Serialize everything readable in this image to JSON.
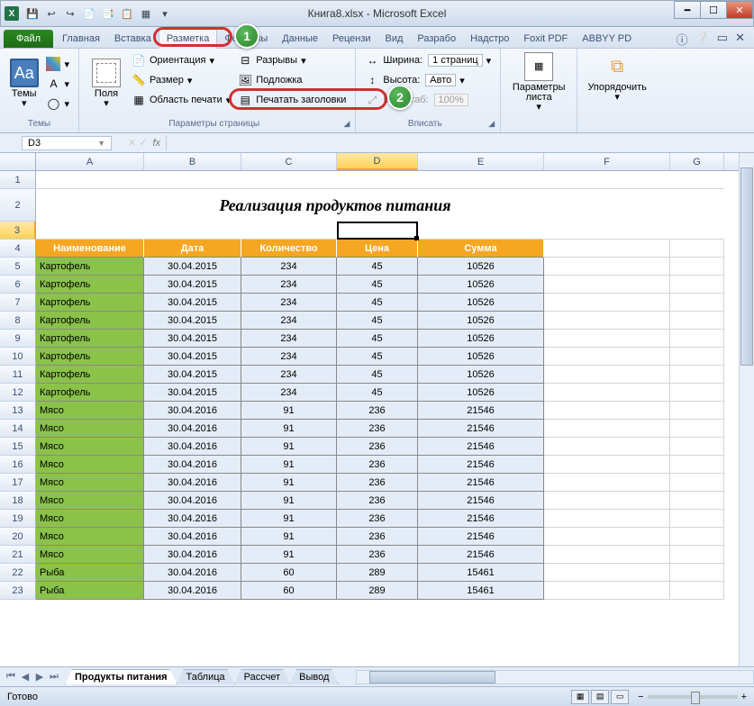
{
  "window": {
    "title": "Книга8.xlsx - Microsoft Excel",
    "qat": [
      "💾",
      "↩",
      "↪",
      "📄",
      "📑",
      "📋",
      "▦",
      "▾"
    ]
  },
  "tabs": {
    "file": "Файл",
    "items": [
      "Главная",
      "Вставка",
      "Разметка",
      "Формулы",
      "Данные",
      "Рецензи",
      "Вид",
      "Разрабо",
      "Надстро",
      "Foxit PDF",
      "ABBYY PD"
    ],
    "active_index": 2
  },
  "ribbon": {
    "themes": {
      "big": "Темы",
      "group": "Темы"
    },
    "page_setup": {
      "margins": "Поля",
      "orientation": "Ориентация",
      "size": "Размер",
      "print_area": "Область печати",
      "breaks": "Разрывы",
      "background": "Подложка",
      "print_titles": "Печатать заголовки",
      "group": "Параметры страницы"
    },
    "scale": {
      "width_lbl": "Ширина:",
      "width_val": "1 страниц",
      "height_lbl": "Высота:",
      "height_val": "Авто",
      "scale_lbl": "Масштаб:",
      "scale_val": "100%",
      "group": "Вписать"
    },
    "sheet_opts": {
      "big": "Параметры листа"
    },
    "arrange": {
      "big": "Упорядочить"
    }
  },
  "namebox": "D3",
  "fx": "fx",
  "columns": [
    "A",
    "B",
    "C",
    "D",
    "E",
    "F",
    "G"
  ],
  "title_text": "Реализация продуктов питания",
  "headers": [
    "Наименование",
    "Дата",
    "Количество",
    "Цена",
    "Сумма"
  ],
  "data_rows": [
    {
      "r": 5,
      "n": "Картофель",
      "d": "30.04.2015",
      "q": "234",
      "p": "45",
      "s": "10526"
    },
    {
      "r": 6,
      "n": "Картофель",
      "d": "30.04.2015",
      "q": "234",
      "p": "45",
      "s": "10526"
    },
    {
      "r": 7,
      "n": "Картофель",
      "d": "30.04.2015",
      "q": "234",
      "p": "45",
      "s": "10526"
    },
    {
      "r": 8,
      "n": "Картофель",
      "d": "30.04.2015",
      "q": "234",
      "p": "45",
      "s": "10526"
    },
    {
      "r": 9,
      "n": "Картофель",
      "d": "30.04.2015",
      "q": "234",
      "p": "45",
      "s": "10526"
    },
    {
      "r": 10,
      "n": "Картофель",
      "d": "30.04.2015",
      "q": "234",
      "p": "45",
      "s": "10526"
    },
    {
      "r": 11,
      "n": "Картофель",
      "d": "30.04.2015",
      "q": "234",
      "p": "45",
      "s": "10526"
    },
    {
      "r": 12,
      "n": "Картофель",
      "d": "30.04.2015",
      "q": "234",
      "p": "45",
      "s": "10526"
    },
    {
      "r": 13,
      "n": "Мясо",
      "d": "30.04.2016",
      "q": "91",
      "p": "236",
      "s": "21546"
    },
    {
      "r": 14,
      "n": "Мясо",
      "d": "30.04.2016",
      "q": "91",
      "p": "236",
      "s": "21546"
    },
    {
      "r": 15,
      "n": "Мясо",
      "d": "30.04.2016",
      "q": "91",
      "p": "236",
      "s": "21546"
    },
    {
      "r": 16,
      "n": "Мясо",
      "d": "30.04.2016",
      "q": "91",
      "p": "236",
      "s": "21546"
    },
    {
      "r": 17,
      "n": "Мясо",
      "d": "30.04.2016",
      "q": "91",
      "p": "236",
      "s": "21546"
    },
    {
      "r": 18,
      "n": "Мясо",
      "d": "30.04.2016",
      "q": "91",
      "p": "236",
      "s": "21546"
    },
    {
      "r": 19,
      "n": "Мясо",
      "d": "30.04.2016",
      "q": "91",
      "p": "236",
      "s": "21546"
    },
    {
      "r": 20,
      "n": "Мясо",
      "d": "30.04.2016",
      "q": "91",
      "p": "236",
      "s": "21546"
    },
    {
      "r": 21,
      "n": "Мясо",
      "d": "30.04.2016",
      "q": "91",
      "p": "236",
      "s": "21546"
    },
    {
      "r": 22,
      "n": "Рыба",
      "d": "30.04.2016",
      "q": "60",
      "p": "289",
      "s": "15461"
    },
    {
      "r": 23,
      "n": "Рыба",
      "d": "30.04.2016",
      "q": "60",
      "p": "289",
      "s": "15461"
    }
  ],
  "sheets": [
    "Продукты питания",
    "Таблица",
    "Рассчет",
    "Вывод"
  ],
  "status": {
    "ready": "Готово",
    "zoom_minus": "−",
    "zoom_plus": "+"
  },
  "callouts": {
    "c1": "1",
    "c2": "2"
  }
}
